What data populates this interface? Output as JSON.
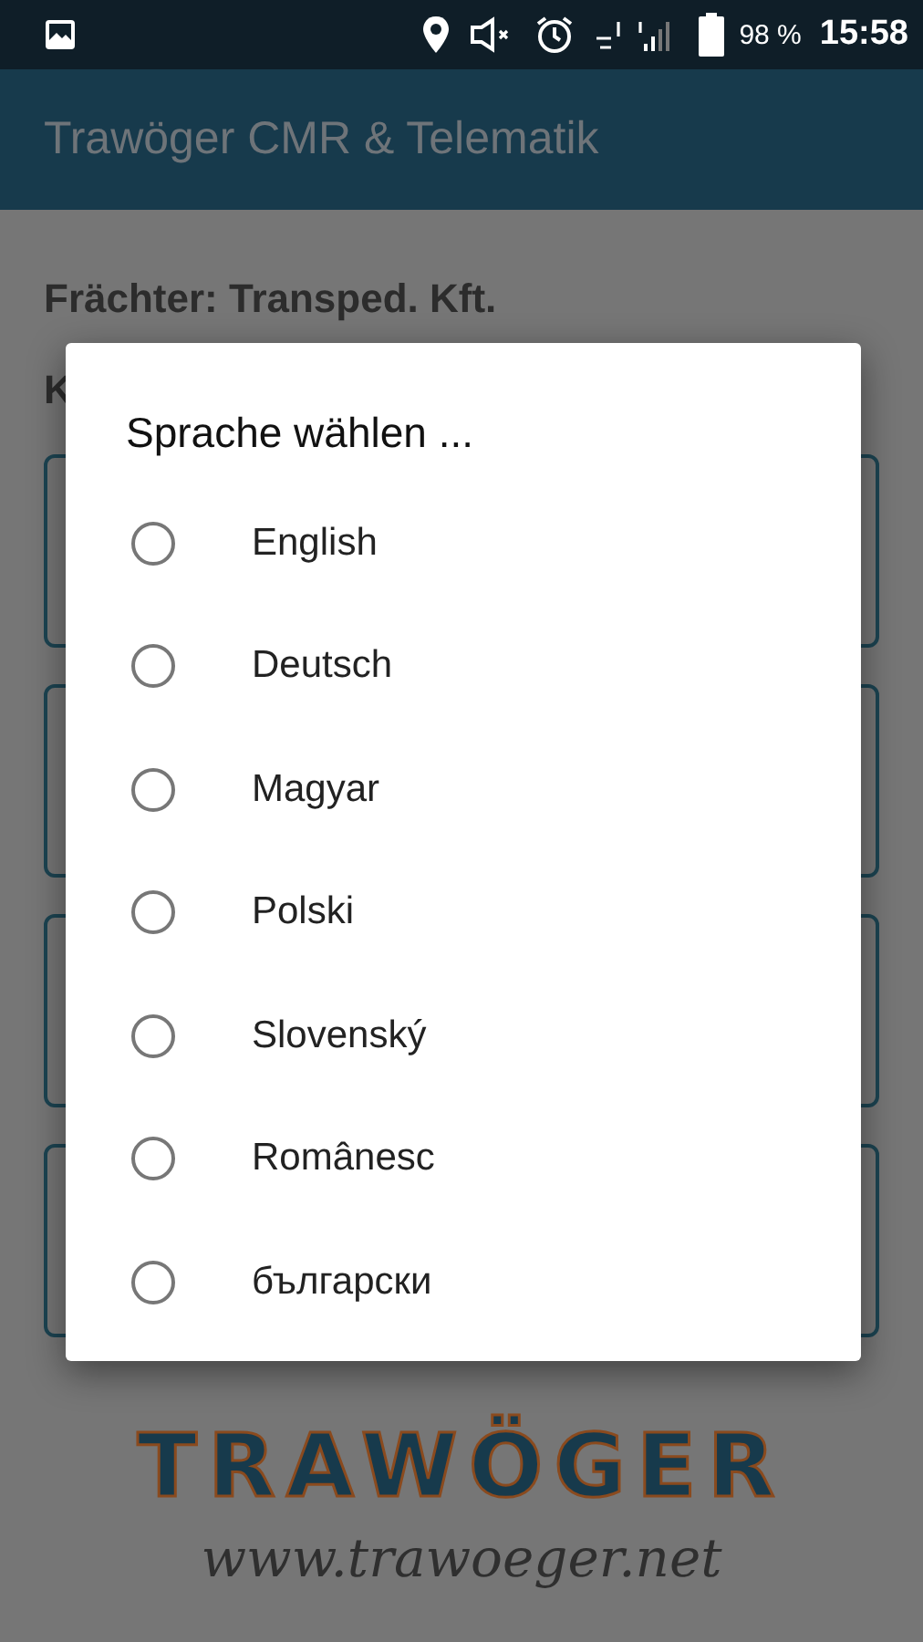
{
  "status_bar": {
    "battery": "98 %",
    "time": "15:58"
  },
  "app_bar": {
    "title": "Trawöger CMR & Telematik"
  },
  "content": {
    "carrier": "Frächter: Transped. Kft.",
    "line_2": "K",
    "cards": [
      {
        "kind": "card"
      },
      {
        "kind": "card"
      },
      {
        "kind": "card"
      },
      {
        "kind": "card"
      }
    ],
    "logo": {
      "name": "TRAWÖGER",
      "url": "www.trawoeger.net"
    }
  },
  "dialog": {
    "title": "Sprache wählen ...",
    "options": [
      {
        "label": "English",
        "selected": false
      },
      {
        "label": "Deutsch",
        "selected": false
      },
      {
        "label": "Magyar",
        "selected": false
      },
      {
        "label": "Polski",
        "selected": false
      },
      {
        "label": "Slovenský",
        "selected": false
      },
      {
        "label": "Românesc",
        "selected": false
      },
      {
        "label": "български",
        "selected": false
      }
    ]
  }
}
